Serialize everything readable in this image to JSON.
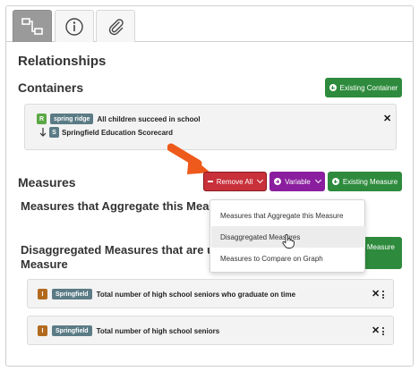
{
  "tabs": [
    {
      "icon": "hierarchy-icon",
      "active": true
    },
    {
      "icon": "info-icon",
      "active": false
    },
    {
      "icon": "paperclip-icon",
      "active": false
    }
  ],
  "relationships_title": "Relationships",
  "containers": {
    "title": "Containers",
    "existing_button": "Existing Container",
    "card": {
      "row1": {
        "badge": "R",
        "tag": "spring ridge",
        "text": "All children succeed in school"
      },
      "row2": {
        "badge": "S",
        "text": "Springfield Education Scorecard"
      }
    }
  },
  "measures": {
    "title": "Measures",
    "remove_all": "Remove All",
    "variable": "Variable",
    "existing_button": "Existing Measure",
    "aggregate_title": "Measures that Aggregate this Measure",
    "disaggregated_title_line1": "Disaggregated Measures that are used to",
    "disaggregated_title_line2": "Measure",
    "hidden_button_partial": "d Measure",
    "rows": [
      {
        "badge": "I",
        "tag": "Springfield",
        "text": "Total number of high school seniors who graduate on time"
      },
      {
        "badge": "I",
        "tag": "Springfield",
        "text": "Total number of high school seniors"
      }
    ]
  },
  "dropdown": {
    "items": [
      "Measures that Aggregate this Measure",
      "Disaggregated Measures",
      "Measures to Compare on Graph"
    ]
  },
  "colors": {
    "green": "#2e8b3d",
    "red": "#c8303a",
    "purple": "#8a1e9e",
    "annotation_arrow": "#ee5a1c"
  }
}
